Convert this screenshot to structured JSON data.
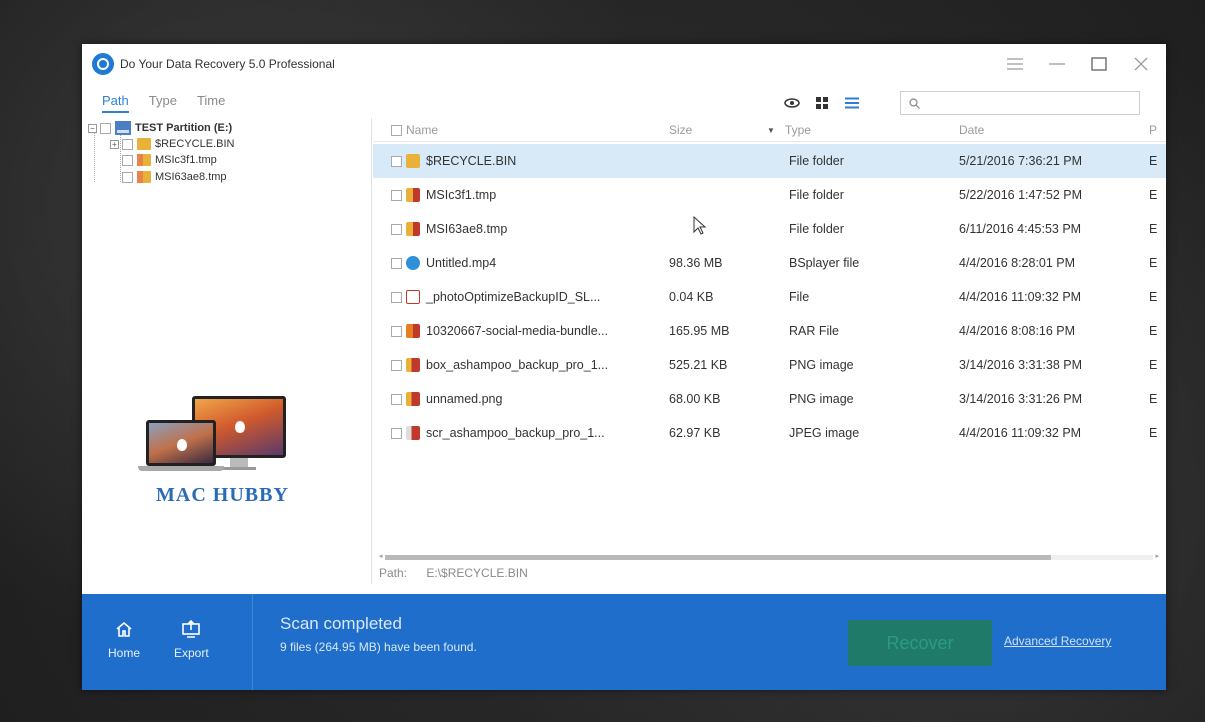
{
  "window": {
    "title": "Do Your Data Recovery 5.0 Professional"
  },
  "toolbar": {
    "tabs": [
      {
        "label": "Path",
        "active": true
      },
      {
        "label": "Type",
        "active": false
      },
      {
        "label": "Time",
        "active": false
      }
    ],
    "search_placeholder": "",
    "search_value": ""
  },
  "tree": {
    "root": {
      "label": "TEST Partition (E:)"
    },
    "children": [
      {
        "label": "$RECYCLE.BIN"
      },
      {
        "label": "MSIc3f1.tmp"
      },
      {
        "label": "MSI63ae8.tmp"
      }
    ]
  },
  "watermark": {
    "text": "MAC HUBBY"
  },
  "list": {
    "columns": {
      "name": "Name",
      "size": "Size",
      "type": "Type",
      "date": "Date",
      "path": "P"
    },
    "rows": [
      {
        "name": "$RECYCLE.BIN",
        "size": "",
        "type": "File folder",
        "date": "5/21/2016 7:36:21 PM",
        "path": "E",
        "icon": "folder-icon"
      },
      {
        "name": "MSIc3f1.tmp",
        "size": "",
        "type": "File folder",
        "date": "5/22/2016 1:47:52 PM",
        "path": "E",
        "icon": "tmp-folder-icon"
      },
      {
        "name": "MSI63ae8.tmp",
        "size": "",
        "type": "File folder",
        "date": "6/11/2016 4:45:53 PM",
        "path": "E",
        "icon": "tmp-folder-icon"
      },
      {
        "name": "Untitled.mp4",
        "size": "98.36 MB",
        "type": "BSplayer file",
        "date": "4/4/2016 8:28:01 PM",
        "path": "E",
        "icon": "video-file-icon"
      },
      {
        "name": "_photoOptimizeBackupID_SL...",
        "size": "0.04 KB",
        "type": "File",
        "date": "4/4/2016 11:09:32 PM",
        "path": "E",
        "icon": "generic-file-icon"
      },
      {
        "name": "10320667-social-media-bundle...",
        "size": "165.95 MB",
        "type": "RAR File",
        "date": "4/4/2016 8:08:16 PM",
        "path": "E",
        "icon": "archive-file-icon"
      },
      {
        "name": "box_ashampoo_backup_pro_1...",
        "size": "525.21 KB",
        "type": "PNG image",
        "date": "3/14/2016 3:31:38 PM",
        "path": "E",
        "icon": "image-file-icon"
      },
      {
        "name": "unnamed.png",
        "size": "68.00 KB",
        "type": "PNG image",
        "date": "3/14/2016 3:31:26 PM",
        "path": "E",
        "icon": "image-file-icon"
      },
      {
        "name": "scr_ashampoo_backup_pro_1...",
        "size": "62.97 KB",
        "type": "JPEG image",
        "date": "4/4/2016 11:09:32 PM",
        "path": "E",
        "icon": "jpeg-file-icon"
      }
    ]
  },
  "path_bar": {
    "label": "Path:",
    "value": "E:\\$RECYCLE.BIN"
  },
  "bottom": {
    "home_label": "Home",
    "export_label": "Export",
    "scan_title": "Scan completed",
    "scan_summary": "9 files (264.95 MB) have been found.",
    "recover_label": "Recover",
    "advanced_label": "Advanced Recovery"
  }
}
